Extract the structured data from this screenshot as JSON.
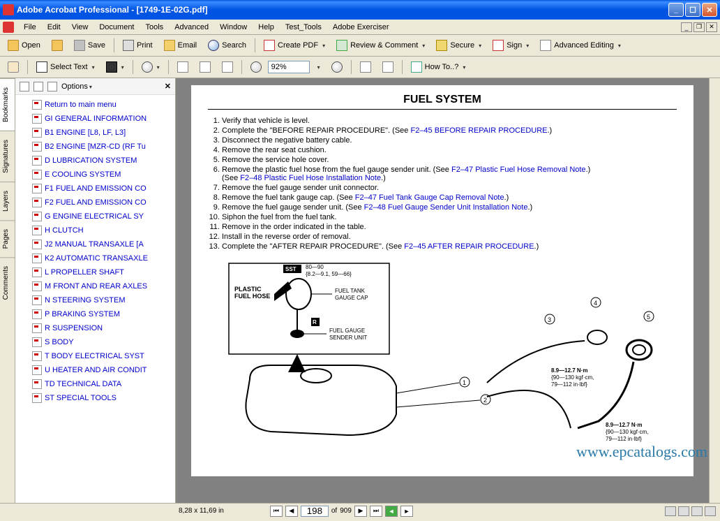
{
  "title": "Adobe Acrobat Professional - [1749-1E-02G.pdf]",
  "menu": [
    "File",
    "Edit",
    "View",
    "Document",
    "Tools",
    "Advanced",
    "Window",
    "Help",
    "Test_Tools",
    "Adobe Exerciser"
  ],
  "toolbar1": {
    "open": "Open",
    "save": "Save",
    "print": "Print",
    "email": "Email",
    "search": "Search",
    "createpdf": "Create PDF",
    "review": "Review & Comment",
    "secure": "Secure",
    "sign": "Sign",
    "advedit": "Advanced Editing"
  },
  "toolbar2": {
    "selecttext": "Select Text",
    "zoom": "92%",
    "howto": "How To..?"
  },
  "sidetabs": [
    "Bookmarks",
    "Signatures",
    "Layers",
    "Pages",
    "Comments"
  ],
  "bm": {
    "options": "Options",
    "items": [
      "Return to main menu",
      "GI GENERAL INFORMATION",
      "B1 ENGINE [L8, LF, L3]",
      "B2 ENGINE [MZR-CD (RF Tu",
      "D LUBRICATION SYSTEM",
      "E COOLING SYSTEM",
      "F1 FUEL AND EMISSION CO",
      "F2 FUEL AND EMISSION CO",
      "G ENGINE ELECTRICAL SY",
      "H CLUTCH",
      "J2 MANUAL TRANSAXLE [A",
      "K2 AUTOMATIC TRANSAXLE",
      "L PROPELLER SHAFT",
      "M FRONT AND REAR AXLES",
      "N STEERING SYSTEM",
      "P BRAKING SYSTEM",
      "R SUSPENSION",
      "S BODY",
      "T BODY ELECTRICAL SYST",
      "U HEATER AND AIR CONDIT",
      "TD TECHNICAL DATA",
      "ST SPECIAL TOOLS"
    ]
  },
  "doc": {
    "heading": "FUEL SYSTEM",
    "steps": [
      {
        "n": 1,
        "t": "Verify that vehicle is level."
      },
      {
        "n": 2,
        "t": "Complete the \"BEFORE REPAIR PROCEDURE\". (See ",
        "link": "F2–45 BEFORE REPAIR PROCEDURE",
        "after": ".)"
      },
      {
        "n": 3,
        "t": "Disconnect the negative battery cable."
      },
      {
        "n": 4,
        "t": "Remove the rear seat cushion."
      },
      {
        "n": 5,
        "t": "Remove the service hole cover."
      },
      {
        "n": 6,
        "t": "Remove the plastic fuel hose from the fuel gauge sender unit. (See ",
        "link": "F2–47 Plastic Fuel Hose Removal Note",
        "after": ".)",
        "sub": {
          "t": "(See ",
          "link": "F2–48 Plastic Fuel Hose Installation Note",
          "after": ".)"
        }
      },
      {
        "n": 7,
        "t": "Remove the fuel gauge sender unit connector."
      },
      {
        "n": 8,
        "t": "Remove the fuel tank gauge cap. (See ",
        "link": "F2–47 Fuel Tank Gauge Cap Removal Note",
        "after": ".)"
      },
      {
        "n": 9,
        "t": "Remove the fuel gauge sender unit. (See ",
        "link": "F2–48 Fuel Gauge Sender Unit Installation Note",
        "after": ".)"
      },
      {
        "n": 10,
        "t": "Siphon the fuel from the fuel tank."
      },
      {
        "n": 11,
        "t": "Remove in the order indicated in the table."
      },
      {
        "n": 12,
        "t": "Install in the reverse order of removal."
      },
      {
        "n": 13,
        "t": "Complete the \"AFTER REPAIR PROCEDURE\". (See ",
        "link": "F2–45 AFTER REPAIR PROCEDURE",
        "after": ".)"
      }
    ],
    "labels": {
      "sst": "SST",
      "torque1": "80—90",
      "torque1b": "{8.2—9.1, 59—66}",
      "plastic": "PLASTIC",
      "fuelhose": "FUEL HOSE",
      "tankgap1": "FUEL TANK",
      "tankgap2": "GAUGE CAP",
      "r": "R",
      "sender1": "FUEL GAUGE",
      "sender2": "SENDER UNIT",
      "tq2a": "8.9—12.7 N·m",
      "tq2b": "{90—130 kgf·cm,",
      "tq2c": "79—112 in·lbf}",
      "tq3a": "8.9—12.7 N·m",
      "tq3b": "{90—130 kgf·cm,",
      "tq3c": "79—112 in·lbf}"
    }
  },
  "watermark": "www.epcatalogs.com",
  "status": {
    "dims": "8,28 x 11,69 in",
    "page": "198",
    "of": "of",
    "total": "909"
  }
}
